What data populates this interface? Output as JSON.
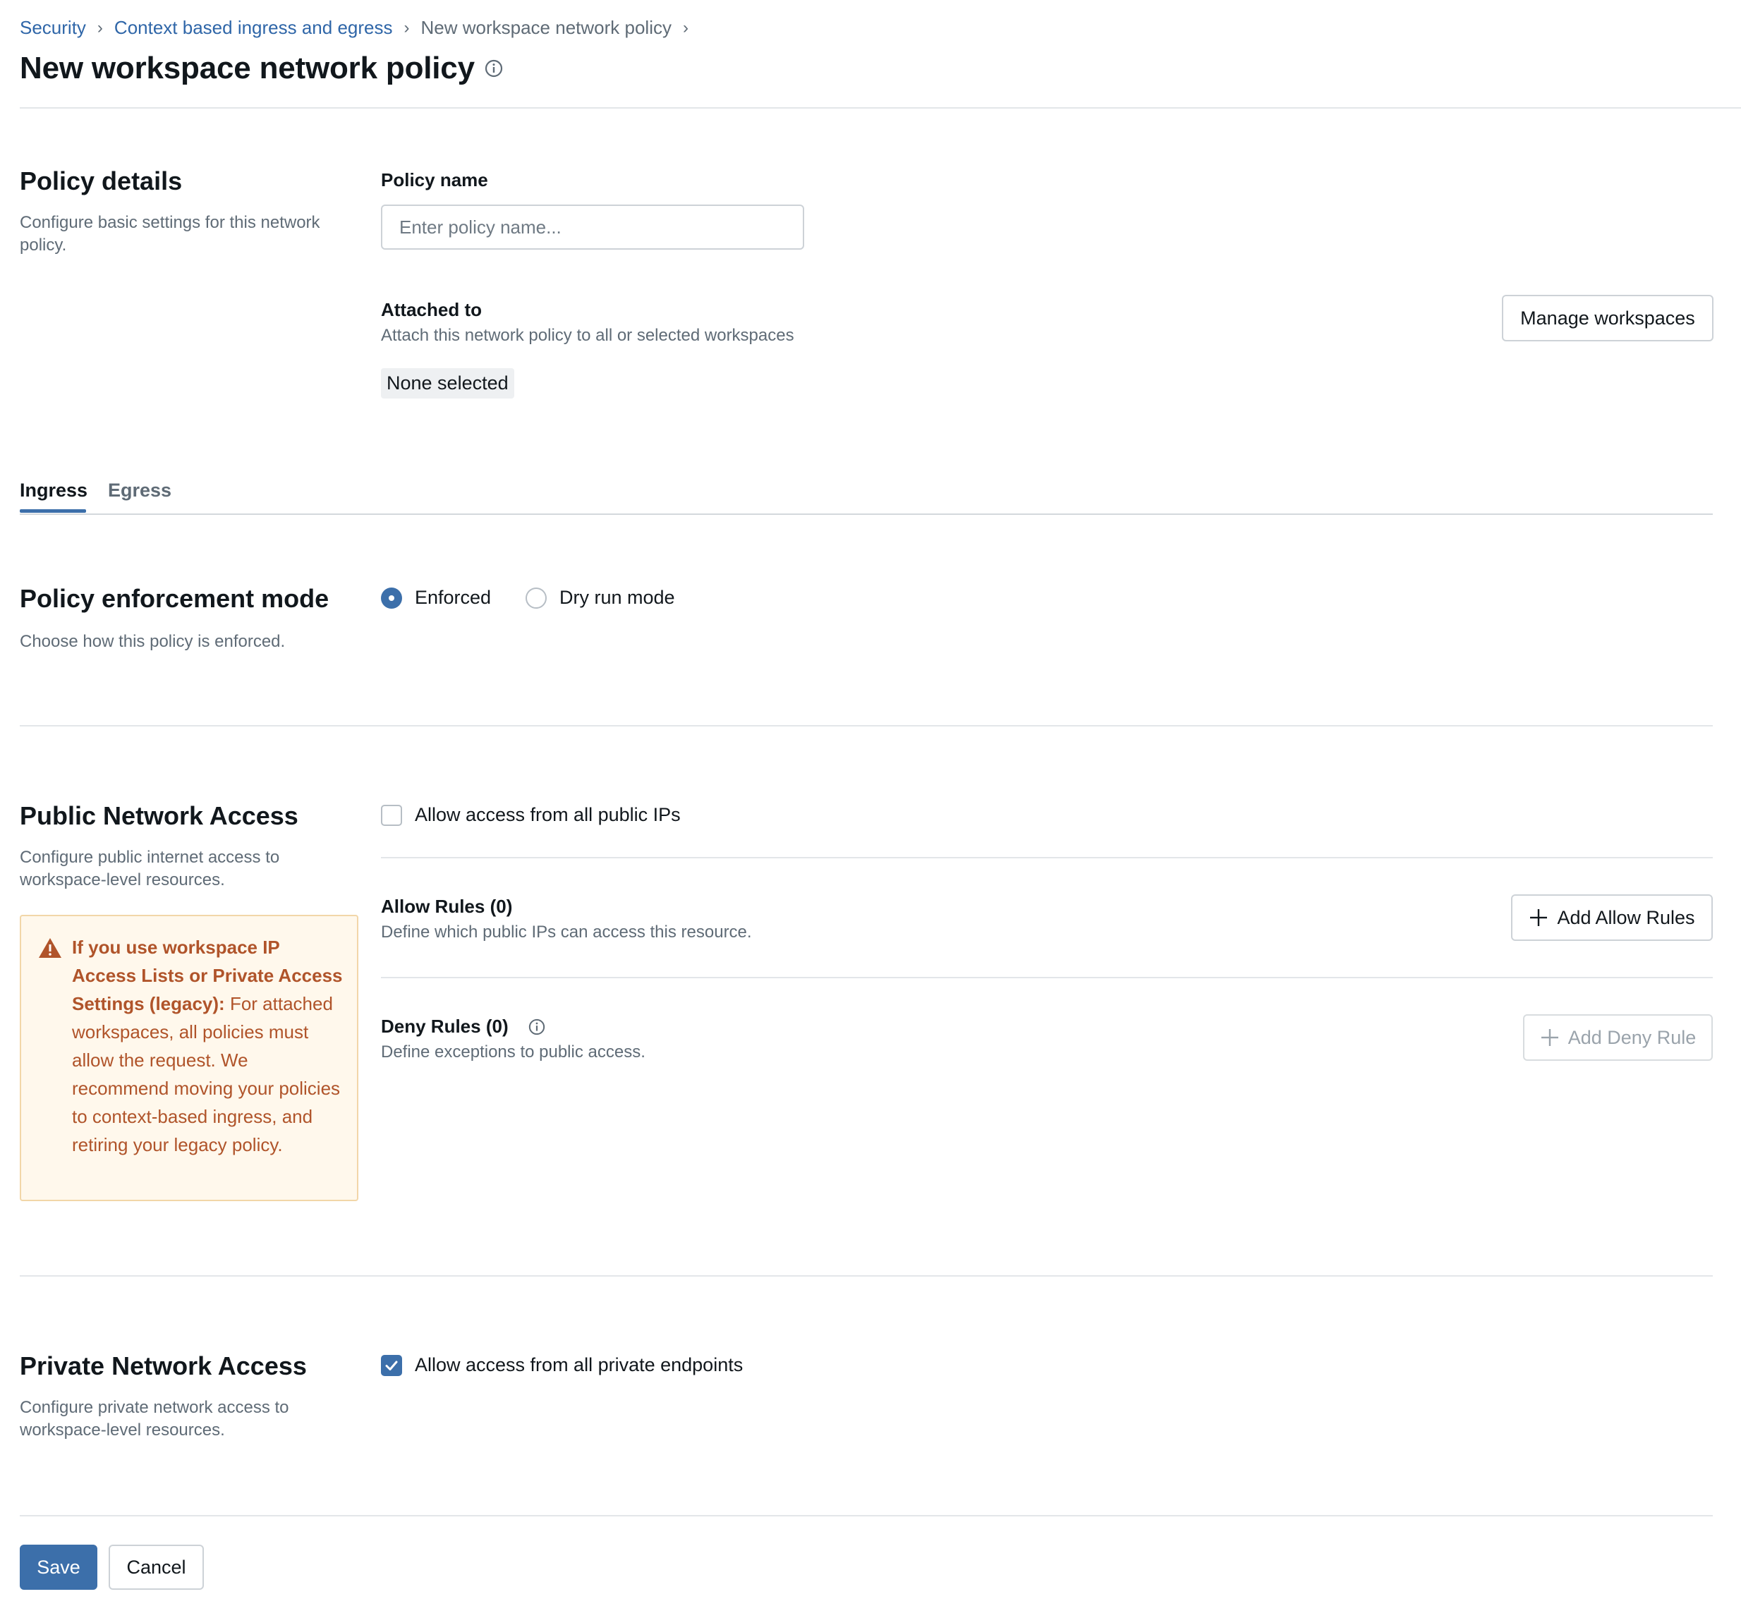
{
  "breadcrumb": {
    "items": [
      "Security",
      "Context based ingress and egress",
      "New workspace network policy"
    ]
  },
  "page": {
    "title": "New workspace network policy"
  },
  "policy_details": {
    "title": "Policy details",
    "description": "Configure basic settings for this network policy.",
    "name_label": "Policy name",
    "name_placeholder": "Enter policy name...",
    "name_value": "",
    "attached_label": "Attached to",
    "attached_desc": "Attach this network policy to all or selected workspaces",
    "attached_value": "None selected",
    "manage_button": "Manage workspaces"
  },
  "tabs": [
    {
      "label": "Ingress",
      "active": true
    },
    {
      "label": "Egress",
      "active": false
    }
  ],
  "enforcement": {
    "title": "Policy enforcement mode",
    "description": "Choose how this policy is enforced.",
    "options": [
      {
        "label": "Enforced",
        "selected": true
      },
      {
        "label": "Dry run mode",
        "selected": false
      }
    ]
  },
  "public_access": {
    "title": "Public Network Access",
    "description": "Configure public internet access to workspace-level resources.",
    "allow_all_label": "Allow access from all public IPs",
    "allow_all_checked": false,
    "warning_bold": "If you use workspace IP Access Lists or Private Access Settings (legacy):",
    "warning_text": "For attached workspaces, all policies must allow the request. We recommend moving your policies to context-based ingress, and retiring your legacy policy.",
    "allow_rules_title": "Allow Rules (0)",
    "allow_rules_desc": "Define which public IPs can access this resource.",
    "add_allow_button": "Add Allow Rules",
    "deny_rules_title": "Deny Rules (0)",
    "deny_rules_desc": "Define exceptions to public access.",
    "add_deny_button": "Add Deny Rule"
  },
  "private_access": {
    "title": "Private Network Access",
    "description": "Configure private network access to workspace-level resources.",
    "allow_all_label": "Allow access from all private endpoints",
    "allow_all_checked": true
  },
  "footer": {
    "save": "Save",
    "cancel": "Cancel"
  },
  "colors": {
    "accent": "#3c6faa",
    "link": "#2f66a8",
    "warning": "#b0542a",
    "warning_bg": "#fff8ec"
  }
}
